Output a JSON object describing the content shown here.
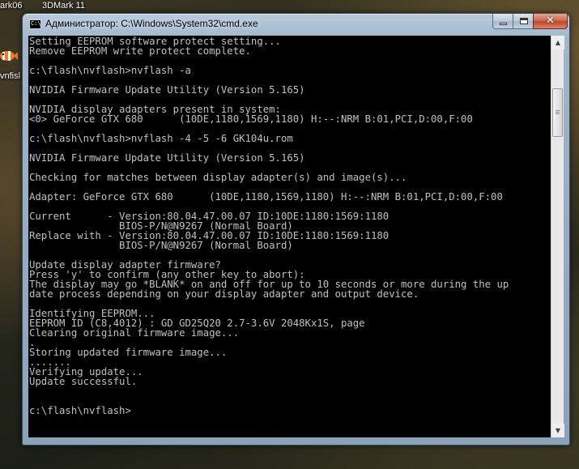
{
  "desktop": {
    "labels": [
      "ark06",
      "3DMark 11",
      "vnfisl"
    ]
  },
  "window": {
    "title": "Администратор: C:\\Windows\\System32\\cmd.exe",
    "icon_label": "C:\\",
    "close_symbol": "✕"
  },
  "console": {
    "text": "Setting EEPROM software protect setting...\nRemove EEPROM write protect complete.\n\nc:\\flash\\nvflash>nvflash -a\n\nNVIDIA Firmware Update Utility (Version 5.165)\n\nNVIDIA display adapters present in system:\n<0> GeForce GTX 680      (10DE,1180,1569,1180) H:--:NRM B:01,PCI,D:00,F:00\n\nc:\\flash\\nvflash>nvflash -4 -5 -6 GK104u.rom\n\nNVIDIA Firmware Update Utility (Version 5.165)\n\nChecking for matches between display adapter(s) and image(s)...\n\nAdapter: GeForce GTX 680      (10DE,1180,1569,1180) H:--:NRM B:01,PCI,D:00,F:00\n\nCurrent      - Version:80.04.47.00.07 ID:10DE:1180:1569:1180\n               BIOS-P/N@N9267 (Normal Board)\nReplace with - Version:80.04.47.00.07 ID:10DE:1180:1569:1180\n               BIOS-P/N@N9267 (Normal Board)\n\nUpdate display adapter firmware?\nPress 'y' to confirm (any other key to abort):\nThe display may go *BLANK* on and off for up to 10 seconds or more during the up\ndate process depending on your display adapter and output device.\n\nIdentifying EEPROM...\nEEPROM ID (C8,4012) : GD GD25Q20 2.7-3.6V 2048Kx1S, page\nClearing original firmware image...\n.\nStoring updated firmware image...\n.......\nVerifying update...\nUpdate successful.\n\n\nc:\\flash\\nvflash>"
  },
  "scrollbar": {
    "up_symbol": "▲",
    "down_symbol": "▼",
    "thumb_position": 0.12
  }
}
